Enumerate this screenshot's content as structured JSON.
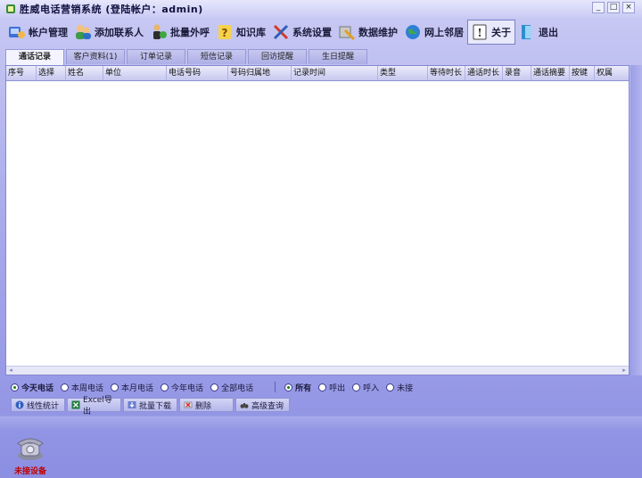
{
  "window": {
    "title": "胜威电话营销系统 (登陆帐户：admin)",
    "controls": [
      "_",
      "□",
      "×"
    ]
  },
  "toolbar": {
    "items": [
      {
        "label": "帐户管理",
        "icon": "account-icon"
      },
      {
        "label": "添加联系人",
        "icon": "add-contact-icon"
      },
      {
        "label": "批量外呼",
        "icon": "batch-call-icon"
      },
      {
        "label": "知识库",
        "icon": "knowledge-icon"
      },
      {
        "label": "系统设置",
        "icon": "tools-icon"
      },
      {
        "label": "数据维护",
        "icon": "data-maintenance-icon"
      },
      {
        "label": "网上邻居",
        "icon": "globe-icon"
      },
      {
        "label": "关于",
        "icon": "info-icon"
      },
      {
        "label": "退出",
        "icon": "exit-icon"
      }
    ]
  },
  "tabs": [
    {
      "label": "通话记录",
      "active": true
    },
    {
      "label": "客户资料(1)",
      "active": false
    },
    {
      "label": "订单记录",
      "active": false
    },
    {
      "label": "短信记录",
      "active": false
    },
    {
      "label": "回访提醒",
      "active": false
    },
    {
      "label": "生日提醒",
      "active": false
    }
  ],
  "grid": {
    "columns": [
      "序号",
      "选择",
      "姓名",
      "单位",
      "电话号码",
      "号码归属地",
      "记录时间",
      "类型",
      "等待时长",
      "通话时长",
      "录音",
      "通话摘要",
      "按键",
      "权属"
    ],
    "rows": []
  },
  "filters": {
    "date": [
      {
        "label": "今天电话",
        "checked": true
      },
      {
        "label": "本周电话",
        "checked": false
      },
      {
        "label": "本月电话",
        "checked": false
      },
      {
        "label": "今年电话",
        "checked": false
      },
      {
        "label": "全部电话",
        "checked": false
      }
    ],
    "direction": [
      {
        "label": "所有",
        "checked": true
      },
      {
        "label": "呼出",
        "checked": false
      },
      {
        "label": "呼入",
        "checked": false
      },
      {
        "label": "未接",
        "checked": false
      }
    ]
  },
  "actions": [
    {
      "label": "线性统计",
      "icon": "info-icon"
    },
    {
      "label": "Excel导出",
      "icon": "excel-icon"
    },
    {
      "label": "批量下载",
      "icon": "download-icon"
    },
    {
      "label": "删除",
      "icon": "delete-icon"
    },
    {
      "label": "高级查询",
      "icon": "binoculars-icon"
    }
  ],
  "device": {
    "label": "未接设备",
    "icon": "telephone-icon"
  },
  "colors": {
    "accent": "#8c8fe2",
    "device_status": "#c00000"
  }
}
